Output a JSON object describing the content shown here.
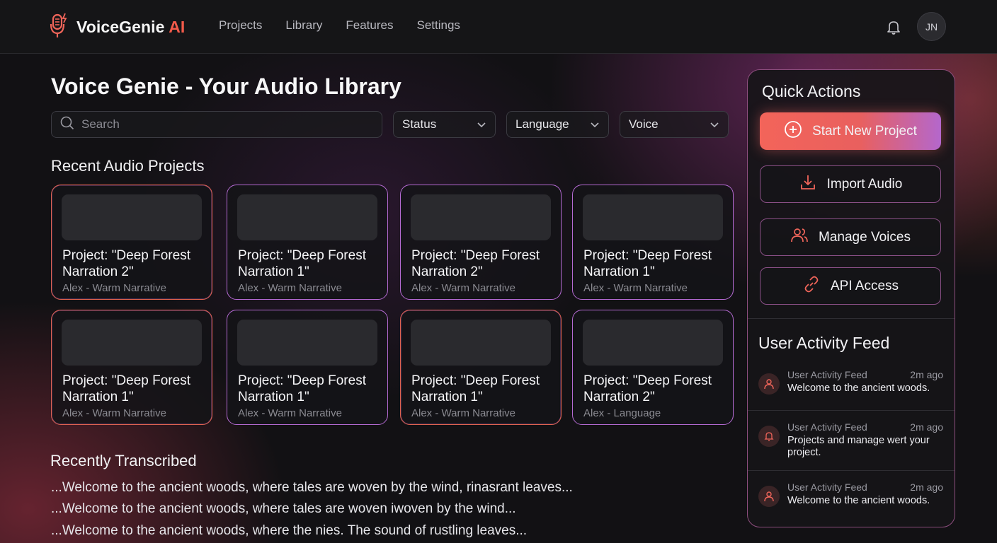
{
  "header": {
    "brand_name": "VoiceGenie",
    "brand_suffix": "AI",
    "nav": [
      "Projects",
      "Library",
      "Features",
      "Settings"
    ],
    "avatar_initials": "JN"
  },
  "main": {
    "title": "Voice Genie - Your Audio Library",
    "search_placeholder": "Search",
    "filters": [
      "Status",
      "Language",
      "Voice"
    ],
    "recent_title": "Recent Audio Projects",
    "projects": [
      {
        "title": "Project: \"Deep Forest Narration 2\"",
        "subtitle": "Alex - Warm Narrative"
      },
      {
        "title": "Project: \"Deep Forest Narration 1\"",
        "subtitle": "Alex - Warm Narrative"
      },
      {
        "title": "Project: \"Deep Forest Narration 2\"",
        "subtitle": "Alex - Warm Narrative"
      },
      {
        "title": "Project: \"Deep Forest Narration 1\"",
        "subtitle": "Alex - Warm Narrative"
      },
      {
        "title": "Project: \"Deep Forest Narration 1\"",
        "subtitle": "Alex - Warm Narrative"
      },
      {
        "title": "Project: \"Deep Forest Narration 1\"",
        "subtitle": "Alex - Warm Narrative"
      },
      {
        "title": "Project: \"Deep Forest Narration 1\"",
        "subtitle": "Alex - Warm Narrative"
      },
      {
        "title": "Project: \"Deep Forest Narration 2\"",
        "subtitle": "Alex - Language"
      }
    ],
    "transcribed_title": "Recently Transcribed",
    "transcripts": [
      "...Welcome to the ancient woods, where tales are woven by the wind, rinasrant leaves...",
      "...Welcome to the ancient woods, where tales are woven iwoven by the wind...",
      "...Welcome to the ancient woods, where the nies. The sound of rustling leaves..."
    ]
  },
  "quick_actions": {
    "title": "Quick Actions",
    "buttons": [
      "Start New Project",
      "Import Audio",
      "Manage Voices",
      "API Access"
    ]
  },
  "activity": {
    "title": "User Activity Feed",
    "items": [
      {
        "head": "User Activity Feed",
        "time": "2m ago",
        "body": "Welcome to the ancient woods.",
        "icon": "user-icon"
      },
      {
        "head": "User Activity Feed",
        "time": "2m ago",
        "body": "Projects and manage wert your project.",
        "icon": "bell-icon"
      },
      {
        "head": "User Activity Feed",
        "time": "2m ago",
        "body": "Welcome to the ancient woods.",
        "icon": "user-icon"
      }
    ]
  },
  "colors": {
    "accent": "#f25a4a",
    "accent_purple": "#b467cc",
    "background": "#121114"
  }
}
